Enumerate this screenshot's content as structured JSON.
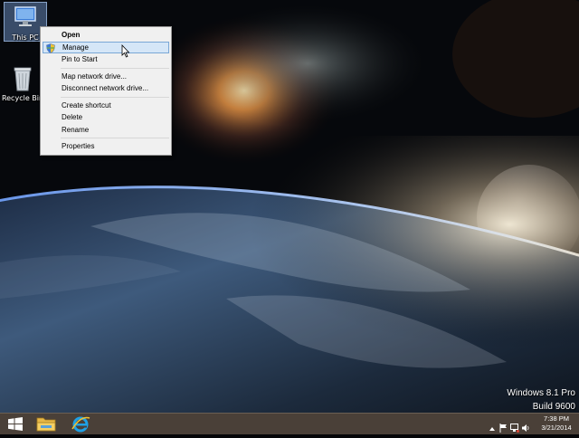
{
  "desktop": {
    "icons": [
      {
        "label": "This PC",
        "icon": "computer-icon"
      },
      {
        "label": "Recycle Bin",
        "icon": "recycle-bin-icon"
      }
    ],
    "watermark": {
      "edition": "Windows 8.1 Pro",
      "build": "Build 9600"
    }
  },
  "context_menu": {
    "items": [
      {
        "label": "Open"
      },
      {
        "label": "Manage"
      },
      {
        "label": "Pin to Start"
      },
      {
        "label": "Map network drive..."
      },
      {
        "label": "Disconnect network drive..."
      },
      {
        "label": "Create shortcut"
      },
      {
        "label": "Delete"
      },
      {
        "label": "Rename"
      },
      {
        "label": "Properties"
      }
    ]
  },
  "taskbar": {
    "pinned": [
      {
        "icon": "file-explorer-icon"
      },
      {
        "icon": "internet-explorer-icon"
      }
    ],
    "tray": {
      "time": "7:38 PM",
      "date": "3/21/2014"
    }
  },
  "colors": {
    "taskbar": "#4a4038",
    "menu_bg": "#f0f0f0",
    "menu_highlight": "#d5e6f7",
    "selection": "#7aa7d6"
  }
}
